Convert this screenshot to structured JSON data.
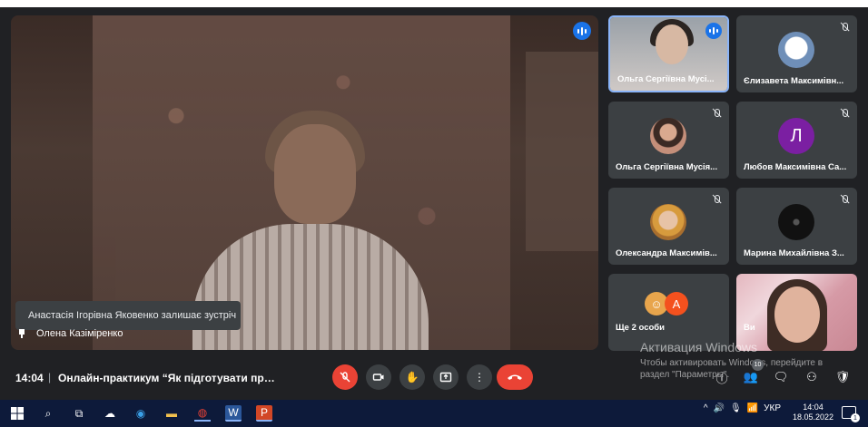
{
  "main_video": {
    "participant_name": "Олена Казіміренко",
    "toast": "Анастасія Ігорівна Яковенко залишає зустріч"
  },
  "tiles": [
    {
      "name": "Ольга Сергіївна Мусі...",
      "type": "camera",
      "speaking": true
    },
    {
      "name": "Єлизавета Максимівн...",
      "type": "photo",
      "muted": true
    },
    {
      "name": "Ольга Сергіївна Мусія...",
      "type": "photo",
      "muted": true
    },
    {
      "name": "Любов Максимівна Са...",
      "type": "letter",
      "letter": "Л",
      "muted": true
    },
    {
      "name": "Олександра Максимів...",
      "type": "photo",
      "muted": true
    },
    {
      "name": "Марина Михайлівна З...",
      "type": "photo",
      "muted": true
    },
    {
      "name": "Ще 2 особи",
      "type": "more",
      "letter": "А"
    },
    {
      "name": "Ви",
      "type": "self"
    }
  ],
  "watermark": {
    "title": "Активация Windows",
    "text": "Чтобы активировать Windows, перейдите в раздел \"Параметры\"."
  },
  "bottom_bar": {
    "time": "14:04",
    "separator": "|",
    "meeting_title": "Онлайн-практикум “Як підготувати презен...",
    "participants_count": "10"
  },
  "taskbar": {
    "language": "УКР",
    "time": "14:04",
    "date": "18.05.2022",
    "notifications": "1"
  },
  "colors": {
    "background": "#202124",
    "tile": "#3c4043",
    "active_border": "#8ab4f8",
    "red": "#ea4335",
    "speaking": "#1a73e8",
    "taskbar": "#0d1a3a"
  }
}
